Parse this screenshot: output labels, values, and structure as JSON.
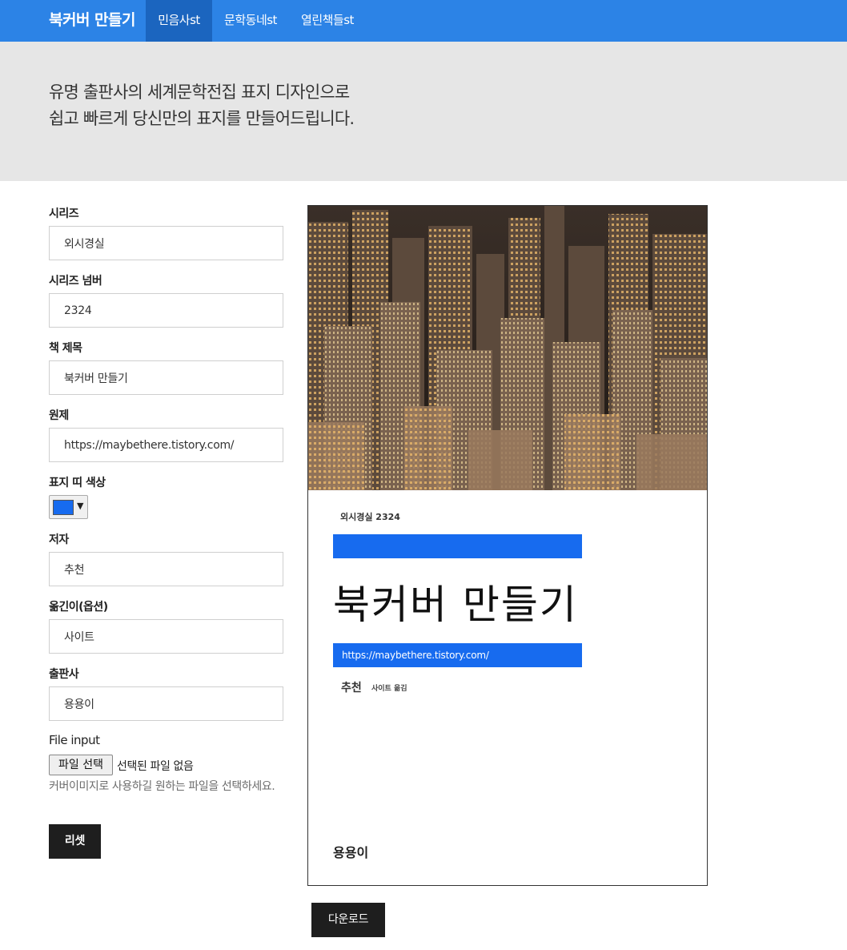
{
  "navbar": {
    "brand": "북커버 만들기",
    "items": [
      {
        "label": "민음사st",
        "active": true
      },
      {
        "label": "문학동네st",
        "active": false
      },
      {
        "label": "열린책들st",
        "active": false
      }
    ]
  },
  "hero": {
    "line1": "유명 출판사의 세계문학전집 표지 디자인으로",
    "line2": "쉽고 빠르게 당신만의 표지를 만들어드립니다."
  },
  "form": {
    "series": {
      "label": "시리즈",
      "value": "외시경실"
    },
    "series_number": {
      "label": "시리즈 넘버",
      "value": "2324"
    },
    "title": {
      "label": "책 제목",
      "value": "북커버 만들기"
    },
    "original_title": {
      "label": "원제",
      "value": "https://maybethere.tistory.com/"
    },
    "band_color": {
      "label": "표지 띠 색상",
      "value": "#176bef"
    },
    "author": {
      "label": "저자",
      "value": "추천"
    },
    "translator": {
      "label": "옮긴이(옵션)",
      "value": "사이트"
    },
    "publisher": {
      "label": "출판사",
      "value": "용용이"
    },
    "file_input": {
      "label": "File input",
      "button": "파일 선택",
      "status": "선택된 파일 없음",
      "help": "커버이미지로 사용하길 원하는 파일을 선택하세요."
    },
    "reset_label": "리셋"
  },
  "cover": {
    "image": "city-night-skyline-photo",
    "series_line": "외시경실 2324",
    "title": "북커버 만들기",
    "original": "https://maybethere.tistory.com/",
    "author": "추천",
    "translator_line": "사이트 옮김",
    "publisher": "용용이",
    "band_color": "#176bef"
  },
  "download_label": "다운로드",
  "colors": {
    "navbar": "#2c83e6",
    "navbar_active": "#1b65bf",
    "hero_bg": "#e6e6e6",
    "button": "#1e1e1e"
  }
}
